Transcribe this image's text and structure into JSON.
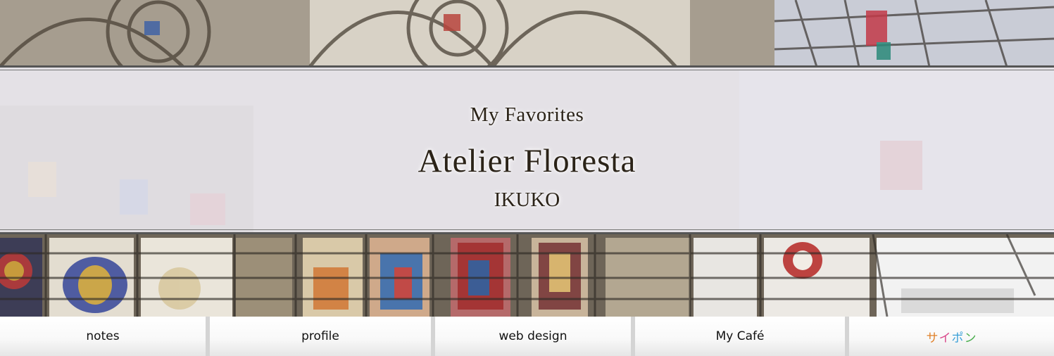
{
  "header": {
    "tagline": "My Favorites",
    "title": "Atelier Floresta",
    "author": "IKUKO",
    "background_image": "stained-glass-cathedral-windows"
  },
  "nav": {
    "items": [
      {
        "label": "notes"
      },
      {
        "label": "profile"
      },
      {
        "label": "web design"
      },
      {
        "label": "My Café"
      },
      {
        "label": "サイポン",
        "chars": [
          "サ",
          "イ",
          "ポ",
          "ン"
        ]
      }
    ]
  },
  "colors": {
    "title_text": "#2b2318",
    "panel": "#f0eef6",
    "rule": "#555555",
    "saipon_chars": [
      "#e0812a",
      "#d94a8c",
      "#3aa0d8",
      "#4caf50"
    ]
  }
}
